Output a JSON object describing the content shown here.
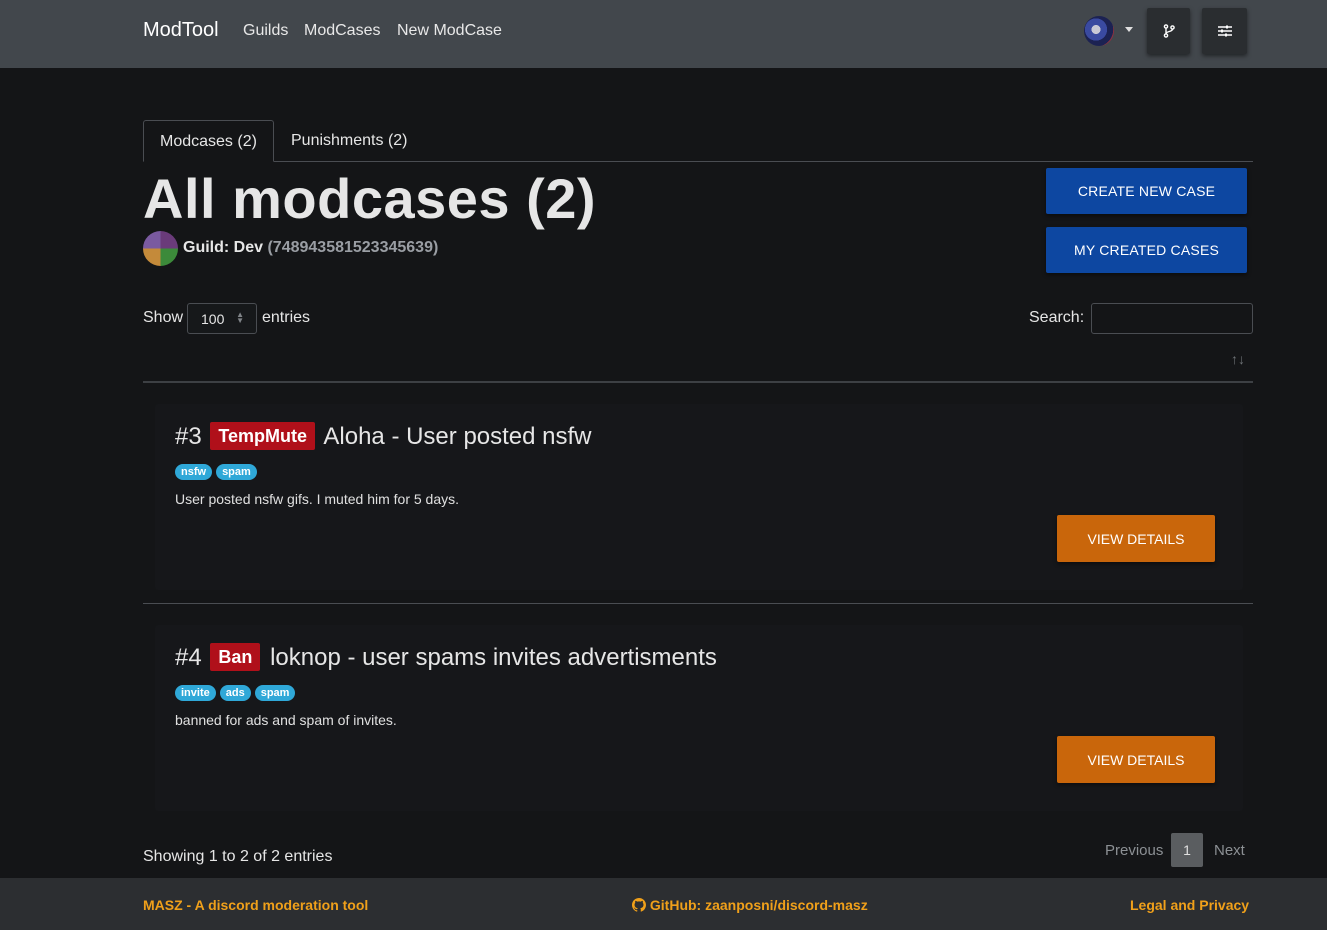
{
  "navbar": {
    "brand": "ModTool",
    "links": [
      "Guilds",
      "ModCases",
      "New ModCase"
    ],
    "branch_icon": "git-branch-icon",
    "settings_icon": "sliders-icon"
  },
  "tabs": [
    {
      "label": "Modcases (2)",
      "active": true
    },
    {
      "label": "Punishments (2)",
      "active": false
    }
  ],
  "header": {
    "title": "All modcases (2)",
    "guild_label": "Guild: Dev",
    "guild_id": "(748943581523345639)",
    "create_button": "CREATE NEW CASE",
    "my_cases_button": "MY CREATED CASES"
  },
  "table_controls": {
    "show_label": "Show",
    "entries_value": "100",
    "entries_label": "entries",
    "search_label": "Search:",
    "search_value": ""
  },
  "cases": [
    {
      "id": "#3",
      "type": "TempMute",
      "title": "Aloha - User posted nsfw",
      "tags": [
        "nsfw",
        "spam"
      ],
      "description": "User posted nsfw gifs. I muted him for 5 days.",
      "button": "VIEW DETAILS"
    },
    {
      "id": "#4",
      "type": "Ban",
      "title": "loknop - user spams invites advertisments",
      "tags": [
        "invite",
        "ads",
        "spam"
      ],
      "description": "banned for ads and spam of invites.",
      "button": "VIEW DETAILS"
    }
  ],
  "pagination": {
    "info": "Showing 1 to 2 of 2 entries",
    "previous": "Previous",
    "current_page": "1",
    "next": "Next"
  },
  "footer": {
    "left": "MASZ - A discord moderation tool",
    "center": "GitHub: zaanposni/discord-masz",
    "right": "Legal and Privacy"
  },
  "colors": {
    "primary": "#0d47a1",
    "accent": "#c9660b",
    "badge_red": "#b0101a",
    "tag_blue": "#2fa8d8",
    "footer_link": "#f0a01a"
  }
}
